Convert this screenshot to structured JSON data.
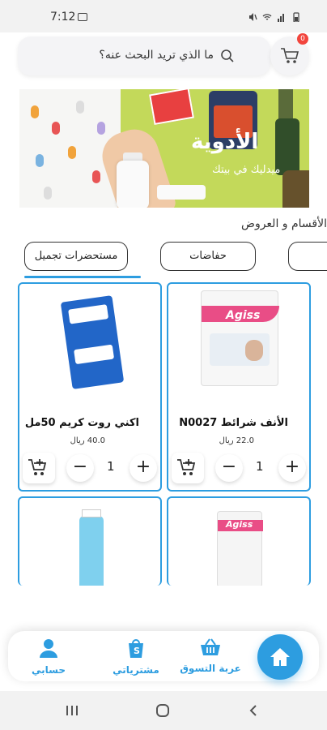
{
  "status_bar": {
    "time": "7:12"
  },
  "search": {
    "placeholder": "ما الذي تريد البحث عنه؟"
  },
  "cart": {
    "badge_count": "0"
  },
  "banner": {
    "title": "الأدوية",
    "subtitle": "ميدليك في بيتك"
  },
  "section": {
    "title": "الأقسام و العروض"
  },
  "tabs": [
    {
      "label": "مستحضرات تجميل",
      "active": true
    },
    {
      "label": "حفاضات",
      "active": false
    },
    {
      "label": "",
      "active": false
    }
  ],
  "products": [
    {
      "name": "الأنف شرائط N0027",
      "price": "22.0 ريال",
      "quantity": "1",
      "image": "agiss-nose-strips"
    },
    {
      "name": "اكني روت كريم 50مل",
      "price": "40.0 ريال",
      "quantity": "1",
      "image": "acne-root-cream"
    },
    {
      "name": "",
      "price": "",
      "quantity": "",
      "image": "agiss-product"
    },
    {
      "name": "",
      "price": "",
      "quantity": "",
      "image": "agiss-tube"
    }
  ],
  "bottom_nav": {
    "home": "home-icon",
    "cart_label": "عربة التسوق",
    "purchases_label": "مشترياتي",
    "account_label": "حسابي"
  },
  "colors": {
    "accent": "#2d9de0",
    "badge": "#f2453d",
    "banner": "#c3d95a"
  }
}
